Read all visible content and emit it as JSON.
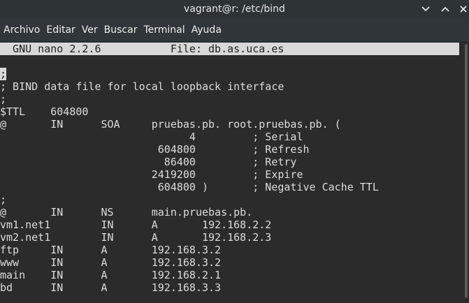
{
  "window": {
    "title": "vagrant@r: /etc/bind",
    "buttons": [
      "chevron-down-icon",
      "chevron-up-icon",
      "close-icon"
    ]
  },
  "menu": {
    "items": [
      "Archivo",
      "Editar",
      "Ver",
      "Buscar",
      "Terminal",
      "Ayuda"
    ]
  },
  "nano": {
    "header": "  GNU nano 2.2.6           File: db.as.uca.es",
    "cursor_char": ";",
    "lines": [
      "",
      ";",
      "; BIND data file for local loopback interface",
      ";",
      "$TTL    604800",
      "@       IN      SOA     pruebas.pb. root.pruebas.pb. (",
      "                              4         ; Serial",
      "                         604800         ; Refresh",
      "                          86400         ; Retry",
      "                        2419200         ; Expire",
      "                         604800 )       ; Negative Cache TTL",
      ";",
      "@       IN      NS      main.pruebas.pb.",
      "vm1.net1        IN      A       192.168.2.2",
      "vm2.net1        IN      A       192.168.2.3",
      "ftp     IN      A       192.168.3.2",
      "www     IN      A       192.168.3.2",
      "main    IN      A       192.168.2.1",
      "bd      IN      A       192.168.3.3"
    ]
  },
  "colors": {
    "terminal_bg": "#2b2b2b",
    "terminal_fg": "#dcdcdc",
    "titlebar_bg": "#2e3436",
    "menubar_bg": "#30363a",
    "nano_header_bg": "#d8d8d8"
  }
}
